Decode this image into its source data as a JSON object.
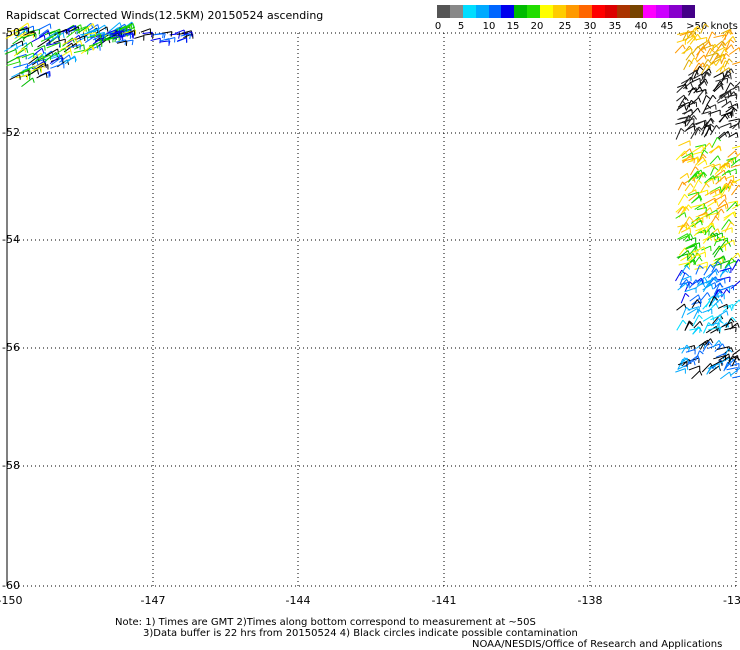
{
  "title": "Rapidscat Corrected Winds(12.5KM) 20150524 ascending",
  "colorbar": {
    "colors": [
      "#555555",
      "#888888",
      "#00ddff",
      "#00aaff",
      "#0066ff",
      "#0000ee",
      "#00bb00",
      "#22dd00",
      "#ffff00",
      "#ffcc00",
      "#ff9900",
      "#ff6600",
      "#ff0000",
      "#dd0000",
      "#aa3300",
      "#774400",
      "#ff00ff",
      "#cc00ff",
      "#8800cc",
      "#440088"
    ],
    "labels": [
      "0",
      "5",
      "10",
      "15",
      "20",
      "25",
      "30",
      "35",
      "40",
      "45",
      ">50 knots"
    ]
  },
  "map": {
    "lon_ticks": [
      "-150",
      "-147",
      "-144",
      "-141",
      "-138",
      "-13"
    ],
    "lat_ticks": [
      "-50",
      "-52",
      "-54",
      "-56",
      "-58",
      "-60"
    ]
  },
  "notes": {
    "line1": "Note: 1) Times are GMT 2)Times along bottom correspond to measurement at ~50S",
    "line2": "3)Data buffer is 22 hrs from 20150524 4) Black circles indicate possible contamination",
    "line3": "NOAA/NESDIS/Office of Research and Applications"
  }
}
